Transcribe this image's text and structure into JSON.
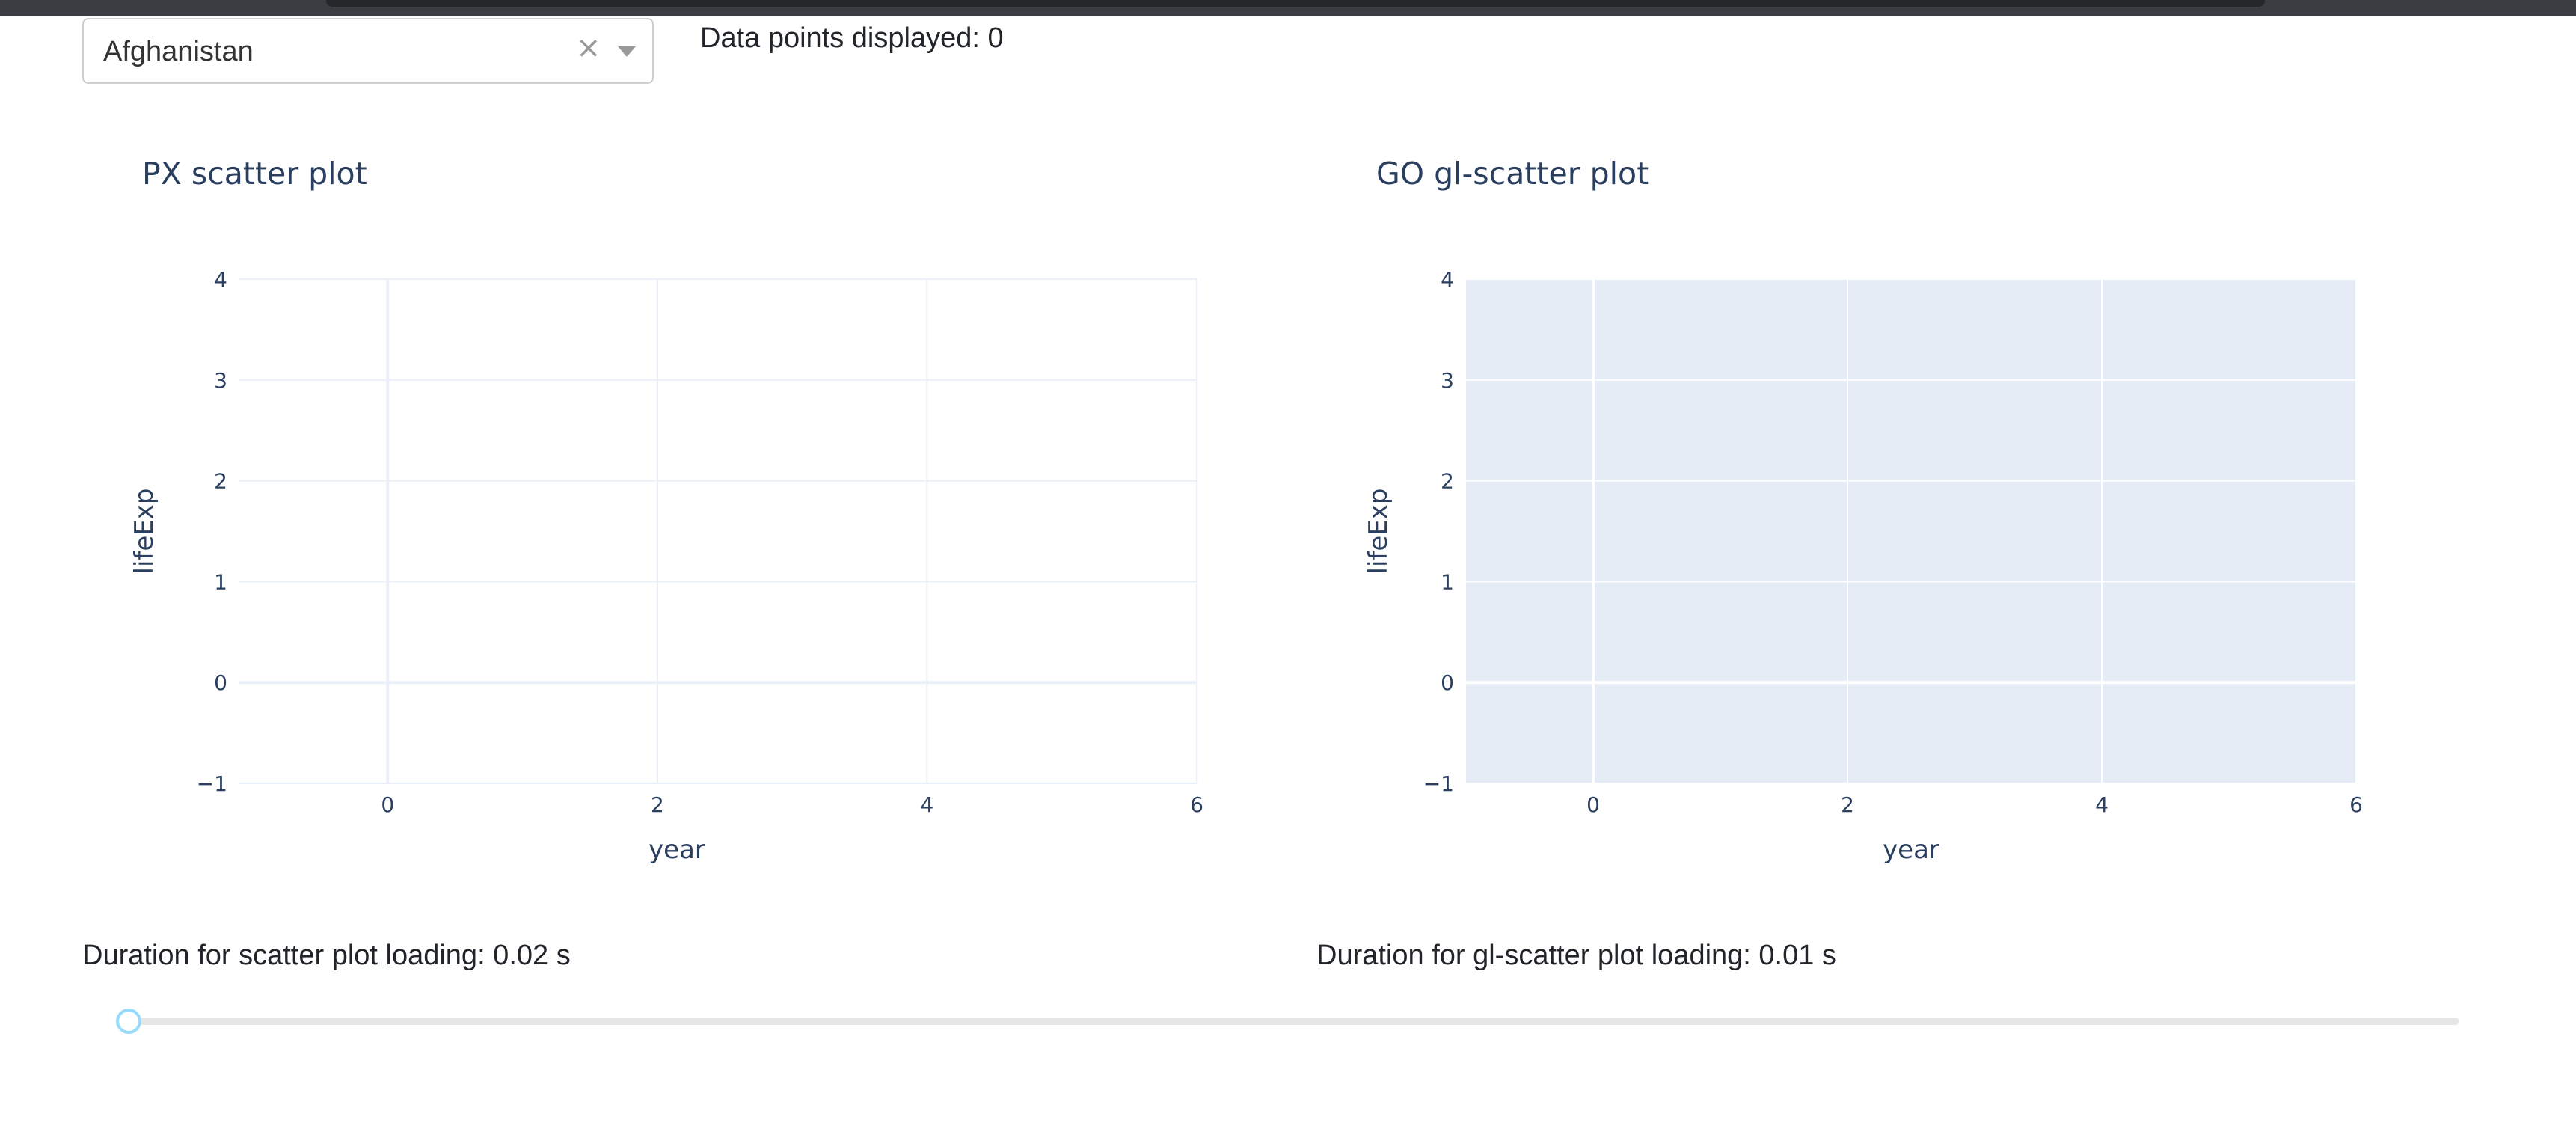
{
  "controls": {
    "country_dropdown": {
      "selected": "Afghanistan",
      "clear_glyph": "×"
    },
    "points_displayed_text": "Data points displayed: 0"
  },
  "charts": [
    {
      "title": "PX scatter plot",
      "xlabel": "year",
      "ylabel": "lifeExp",
      "plot_bg": "#ffffff",
      "grid_color": "#ebf0f8",
      "zero_line_color": "#ebf0f8",
      "xticks": [
        "0",
        "2",
        "4",
        "6"
      ],
      "yticks": [
        "−1",
        "0",
        "1",
        "2",
        "3",
        "4"
      ]
    },
    {
      "title": "GO gl-scatter plot",
      "xlabel": "year",
      "ylabel": "lifeExp",
      "plot_bg": "#e5ecf6",
      "grid_color": "#ffffff",
      "zero_line_color": "#ffffff",
      "xticks": [
        "0",
        "2",
        "4",
        "6"
      ],
      "yticks": [
        "−1",
        "0",
        "1",
        "2",
        "3",
        "4"
      ]
    }
  ],
  "chart_data": [
    {
      "type": "scatter",
      "title": "PX scatter plot",
      "xlabel": "year",
      "ylabel": "lifeExp",
      "x": [],
      "y": [],
      "xlim": [
        -1.1,
        6
      ],
      "ylim": [
        -1,
        4
      ],
      "x_tick_values": [
        0,
        2,
        4,
        6
      ],
      "y_tick_values": [
        -1,
        0,
        1,
        2,
        3,
        4
      ],
      "grid": true
    },
    {
      "type": "scatter",
      "title": "GO gl-scatter plot",
      "xlabel": "year",
      "ylabel": "lifeExp",
      "x": [],
      "y": [],
      "xlim": [
        -1,
        6
      ],
      "ylim": [
        -1,
        4
      ],
      "x_tick_values": [
        0,
        2,
        4,
        6
      ],
      "y_tick_values": [
        -1,
        0,
        1,
        2,
        3,
        4
      ],
      "grid": true
    }
  ],
  "footer": {
    "scatter_duration": "Duration for scatter plot loading: 0.02 s",
    "gl_duration": "Duration for gl-scatter plot loading: 0.01 s"
  },
  "slider": {
    "value_fraction": 0,
    "track_color": "#e6e6e6",
    "handle_border_color": "#96dbfa"
  },
  "colors": {
    "text_dark": "#212529",
    "plotly_text": "#2a3f5f"
  }
}
